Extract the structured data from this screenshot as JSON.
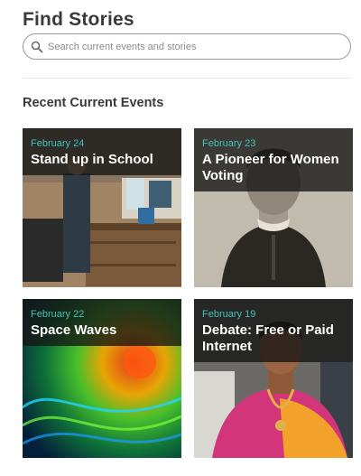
{
  "header": {
    "title": "Find Stories"
  },
  "search": {
    "placeholder": "Search current events and stories",
    "icon": "search-icon"
  },
  "section": {
    "title": "Recent Current Events"
  },
  "stories": [
    {
      "date": "February 24",
      "title": "Stand up in School"
    },
    {
      "date": "February 23",
      "title": "A Pioneer for Women Voting"
    },
    {
      "date": "February 22",
      "title": "Space Waves"
    },
    {
      "date": "February 19",
      "title": "Debate: Free or Paid Internet"
    }
  ],
  "colors": {
    "date_accent": "#3fc3b8",
    "overlay": "#141414",
    "heading": "#3a3a3a"
  }
}
